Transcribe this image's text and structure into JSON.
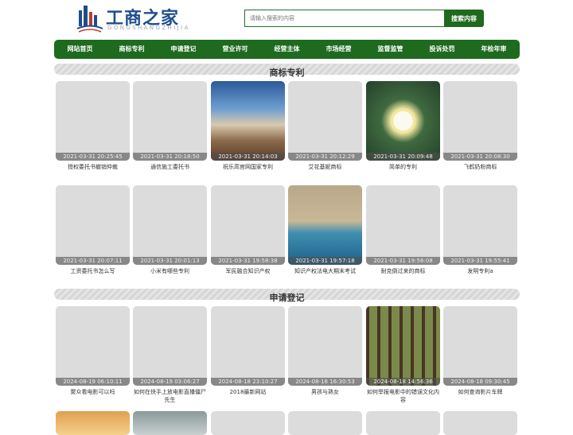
{
  "site": {
    "logo_text": "工商之家",
    "logo_sub": "GONGSHANGZHIJIA",
    "search_placeholder": "请输入搜索的内容",
    "search_button": "搜索内容"
  },
  "colors": {
    "brand_green": "#1e6a1e",
    "logo_blue": "#1f4d8c"
  },
  "nav": [
    "网站首页",
    "商标专利",
    "申请登记",
    "营业许可",
    "经营主体",
    "市场经营",
    "监督监管",
    "投诉处罚",
    "年检年审"
  ],
  "sections": [
    {
      "title": "商标专利",
      "items": [
        {
          "date": "2021-03-31 20:25:45",
          "caption": "授权委托书撤销仲裁",
          "thumb": "placeholder"
        },
        {
          "date": "2021-03-31 20:18:50",
          "caption": "通信施工委托书",
          "thumb": "placeholder"
        },
        {
          "date": "2021-03-31 20:14:03",
          "caption": "祝乐高官网国家专利",
          "thumb": "sky"
        },
        {
          "date": "2021-03-31 20:12:29",
          "caption": "艾花基妮商标",
          "thumb": "placeholder"
        },
        {
          "date": "2021-03-31 20:09:48",
          "caption": "简单的专利",
          "thumb": "lotus"
        },
        {
          "date": "2021-03-31 20:08:30",
          "caption": "飞鹤奶粉商标",
          "thumb": "placeholder"
        },
        {
          "date": "2021-03-31 20:07:11",
          "caption": "工资委托书怎么写",
          "thumb": "placeholder"
        },
        {
          "date": "2021-03-31 20:01:13",
          "caption": "小米有哪些专利",
          "thumb": "placeholder"
        },
        {
          "date": "2021-03-31 19:58:38",
          "caption": "军民融合知识产权",
          "thumb": "placeholder"
        },
        {
          "date": "2021-03-31 19:57:18",
          "caption": "知识产权法电大期末考试",
          "thumb": "coast"
        },
        {
          "date": "2021-03-31 19:56:08",
          "caption": "耐克倒过来的商标",
          "thumb": "placeholder"
        },
        {
          "date": "2021-03-31 19:55:41",
          "caption": "发明专利a",
          "thumb": "placeholder"
        }
      ]
    },
    {
      "title": "申请登记",
      "items": [
        {
          "date": "2024-08-19 06:10:11",
          "caption": "聚众看电影可以吗",
          "thumb": "placeholder"
        },
        {
          "date": "2024-08-19 03:06:27",
          "caption": "如何在快手上放电影直播僵尸先生",
          "thumb": "placeholder"
        },
        {
          "date": "2024-08-18 23:10:27",
          "caption": "2018最新网站",
          "thumb": "placeholder"
        },
        {
          "date": "2024-08-18 16:30:53",
          "caption": "男孩与熟女",
          "thumb": "placeholder"
        },
        {
          "date": "2024-08-18 14:56:36",
          "caption": "如何举报电影中的错误文化内容",
          "thumb": "forest"
        },
        {
          "date": "2024-08-18 09:30:45",
          "caption": "如何查询影片车牌",
          "thumb": "placeholder"
        }
      ]
    }
  ]
}
